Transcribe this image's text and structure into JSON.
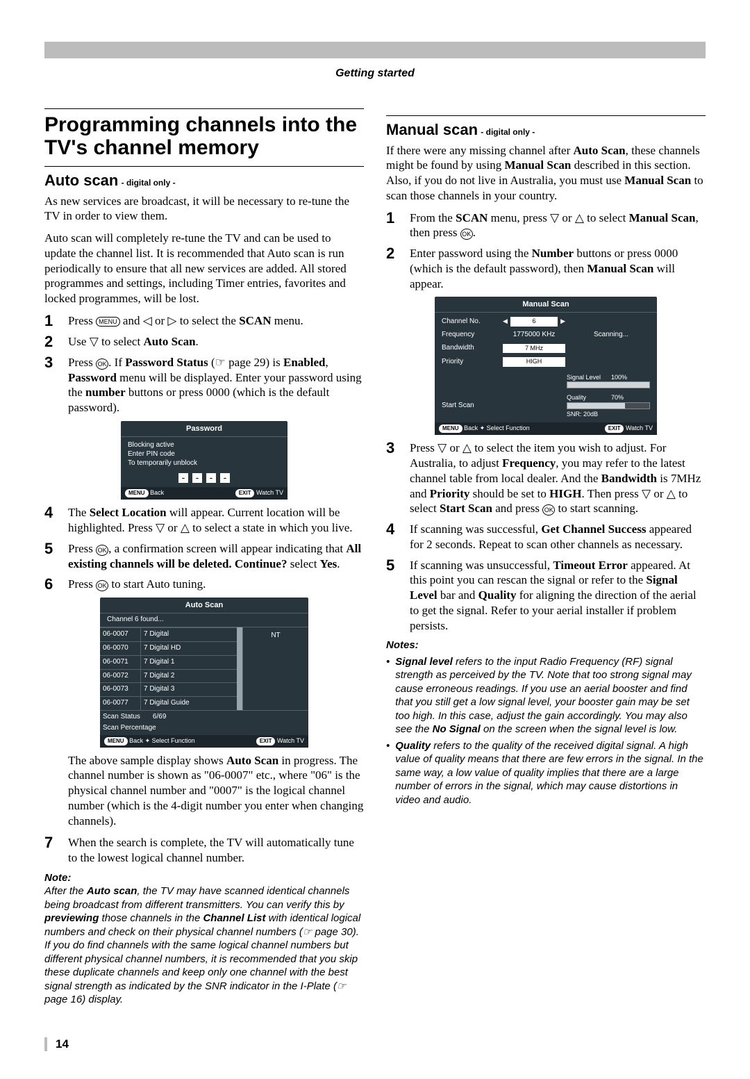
{
  "header": {
    "section": "Getting started"
  },
  "page_number": "14",
  "left": {
    "title": "Programming channels into the TV's channel memory",
    "auto_scan": {
      "heading": "Auto scan",
      "subheading": "- digital only -",
      "intro1": "As new services are broadcast, it will be necessary to re-tune the TV in order to view them.",
      "intro2": "Auto scan will completely re-tune the TV and can be used to update the channel list. It is recommended that Auto scan is run periodically to ensure that all new services are added. All stored programmes and settings, including Timer entries, favorites and locked programmes, will be lost.",
      "steps": {
        "s1a": "Press ",
        "s1_menu": "MENU",
        "s1b": " and ◁ or ▷ to select the ",
        "s1_scan": "SCAN",
        "s1c": " menu.",
        "s2a": "Use ▽ to select ",
        "s2_auto": "Auto Scan",
        "s2b": ".",
        "s3a": "Press ",
        "s3_ok": "OK",
        "s3b": ". If ",
        "s3_ps": "Password Status",
        "s3c": " (☞ page 29) is ",
        "s3_en": "Enabled",
        "s3d": ", ",
        "s3_pw": "Password",
        "s3e": " menu will be displayed. Enter your password using the ",
        "s3_num": "number",
        "s3f": " buttons or press 0000 (which is the default password).",
        "s4a": "The ",
        "s4_sl": "Select Location",
        "s4b": " will appear. Current location will be highlighted. Press ▽ or △ to select a state in which you live.",
        "s5a": "Press ",
        "s5_ok": "OK",
        "s5b": ", a confirmation screen will appear indicating that ",
        "s5_msg": "All existing channels will be deleted. Continue?",
        "s5c": " select ",
        "s5_yes": "Yes",
        "s5d": ".",
        "s6a": "Press ",
        "s6_ok": "OK",
        "s6b": " to start Auto tuning.",
        "s7": "When the search is complete, the TV will automatically tune to the lowest logical channel number."
      },
      "password_osd": {
        "title": "Password",
        "line1": "Blocking active",
        "line2": "Enter PIN code",
        "line3": "To temporarily unblock",
        "foot_menu": "MENU",
        "foot_back": "Back",
        "foot_exit": "EXIT",
        "foot_watch": "Watch TV"
      },
      "auto_osd": {
        "title": "Auto Scan",
        "found": "Channel 6 found...",
        "rows": [
          {
            "no": "06-0007",
            "name": "7 Digital"
          },
          {
            "no": "06-0070",
            "name": "7 Digital HD"
          },
          {
            "no": "06-0071",
            "name": "7 Digital 1"
          },
          {
            "no": "06-0072",
            "name": "7 Digital 2"
          },
          {
            "no": "06-0073",
            "name": "7 Digital 3"
          },
          {
            "no": "06-0077",
            "name": "7 Digital Guide"
          }
        ],
        "right_label": "NT",
        "scan_status_label": "Scan Status",
        "scan_status_val": "6/69",
        "scan_percentage_label": "Scan Percentage",
        "foot_menu": "MENU",
        "foot_back": "Back",
        "foot_select": "Select Function",
        "foot_exit": "EXIT",
        "foot_watch": "Watch TV"
      },
      "after_table1": "The above sample display shows ",
      "after_table1b": "Auto Scan",
      "after_table1c": " in progress. The channel number is shown as \"06-0007\" etc., where \"06\" is the physical channel number and \"0007\" is the logical channel number (which is the 4-digit number you enter when changing channels).",
      "note_head": "Note:",
      "note_body_a": "After the ",
      "note_body_b": "Auto scan",
      "note_body_c": ", the TV may have scanned identical channels being broadcast from different transmitters. You can verify this by ",
      "note_body_d": "previewing",
      "note_body_e": " those channels in the ",
      "note_body_f": "Channel List",
      "note_body_g": " with identical logical numbers and check on their physical channel numbers (☞ page 30). If you do find channels with the same logical channel numbers but different physical channel numbers, it is recommended that you skip these duplicate channels and keep only one channel with the best signal strength as indicated by the SNR indicator in the I-Plate (☞ page 16) display."
    }
  },
  "right": {
    "manual_scan": {
      "heading": "Manual scan",
      "subheading": "- digital only -",
      "intro_a": "If there were any missing channel after ",
      "intro_b": "Auto Scan",
      "intro_c": ", these channels might be found by using ",
      "intro_d": "Manual Scan",
      "intro_e": " described in this section. Also, if you do not live in Australia, you must use ",
      "intro_f": "Manual Scan",
      "intro_g": " to scan those channels in your country.",
      "steps": {
        "s1a": "From the ",
        "s1_scan": "SCAN",
        "s1b": " menu, press ▽ or △ to select ",
        "s1_ms": "Manual Scan",
        "s1c": ", then press ",
        "s1_ok": "OK",
        "s1d": ".",
        "s2a": "Enter password using the ",
        "s2_num": "Number",
        "s2b": " buttons or press 0000 (which is the default password), then ",
        "s2_ms": "Manual Scan",
        "s2c": " will appear.",
        "s3a": "Press ▽ or △ to select the item you wish to adjust. For Australia, to adjust ",
        "s3_freq": "Frequency",
        "s3b": ", you may refer to the latest channel table from local dealer. And the ",
        "s3_bw": "Bandwidth",
        "s3c": " is 7MHz and ",
        "s3_pri": "Priority",
        "s3d": " should be set to ",
        "s3_high": "HIGH",
        "s3e": ". Then press ▽ or △ to select ",
        "s3_start": "Start Scan",
        "s3f": " and press ",
        "s3_ok": "OK",
        "s3g": " to start scanning.",
        "s4a": "If scanning was successful, ",
        "s4_gcs": "Get Channel Success",
        "s4b": " appeared for 2 seconds. Repeat to scan other channels as necessary.",
        "s5a": "If scanning was unsuccessful, ",
        "s5_te": "Timeout Error",
        "s5b": " appeared. At this point you can rescan the signal or refer to the ",
        "s5_sl": "Signal Level",
        "s5c": " bar and ",
        "s5_q": "Quality",
        "s5d": " for aligning the direction of the aerial to get the signal. Refer to your aerial installer if problem persists."
      },
      "osd": {
        "title": "Manual Scan",
        "channel_no_label": "Channel No.",
        "channel_no_val": "6",
        "freq_label": "Frequency",
        "freq_val": "1775000  KHz",
        "bw_label": "Bandwidth",
        "bw_val": "7 MHz",
        "pri_label": "Priority",
        "pri_val": "HIGH",
        "scanning": "Scanning...",
        "start_label": "Start Scan",
        "signal_label": "Signal Level",
        "signal_pct": "100%",
        "signal_fill": 100,
        "quality_label": "Quality",
        "quality_pct": "70%",
        "quality_fill": 70,
        "snr": "SNR: 20dB",
        "foot_menu": "MENU",
        "foot_back": "Back",
        "foot_select": "Select Function",
        "foot_exit": "EXIT",
        "foot_watch": "Watch TV"
      },
      "notes_head": "Notes:",
      "note1a": "Signal level",
      "note1b": " refers to the input Radio Frequency (RF) signal strength as perceived by the TV. Note that too strong signal may cause erroneous readings. If you use an aerial booster and find that you still get a low signal level, your booster gain may be set too high. In this case, adjust the gain accordingly. You may also see the ",
      "note1c": "No Signal",
      "note1d": " on the screen when the signal level is low.",
      "note2a": "Quality",
      "note2b": " refers to the quality of the received digital signal. A high value of quality means that there are few errors in the signal. In the same way, a low value of quality implies that there are a large number of errors in the signal, which may cause distortions in video and audio."
    }
  }
}
